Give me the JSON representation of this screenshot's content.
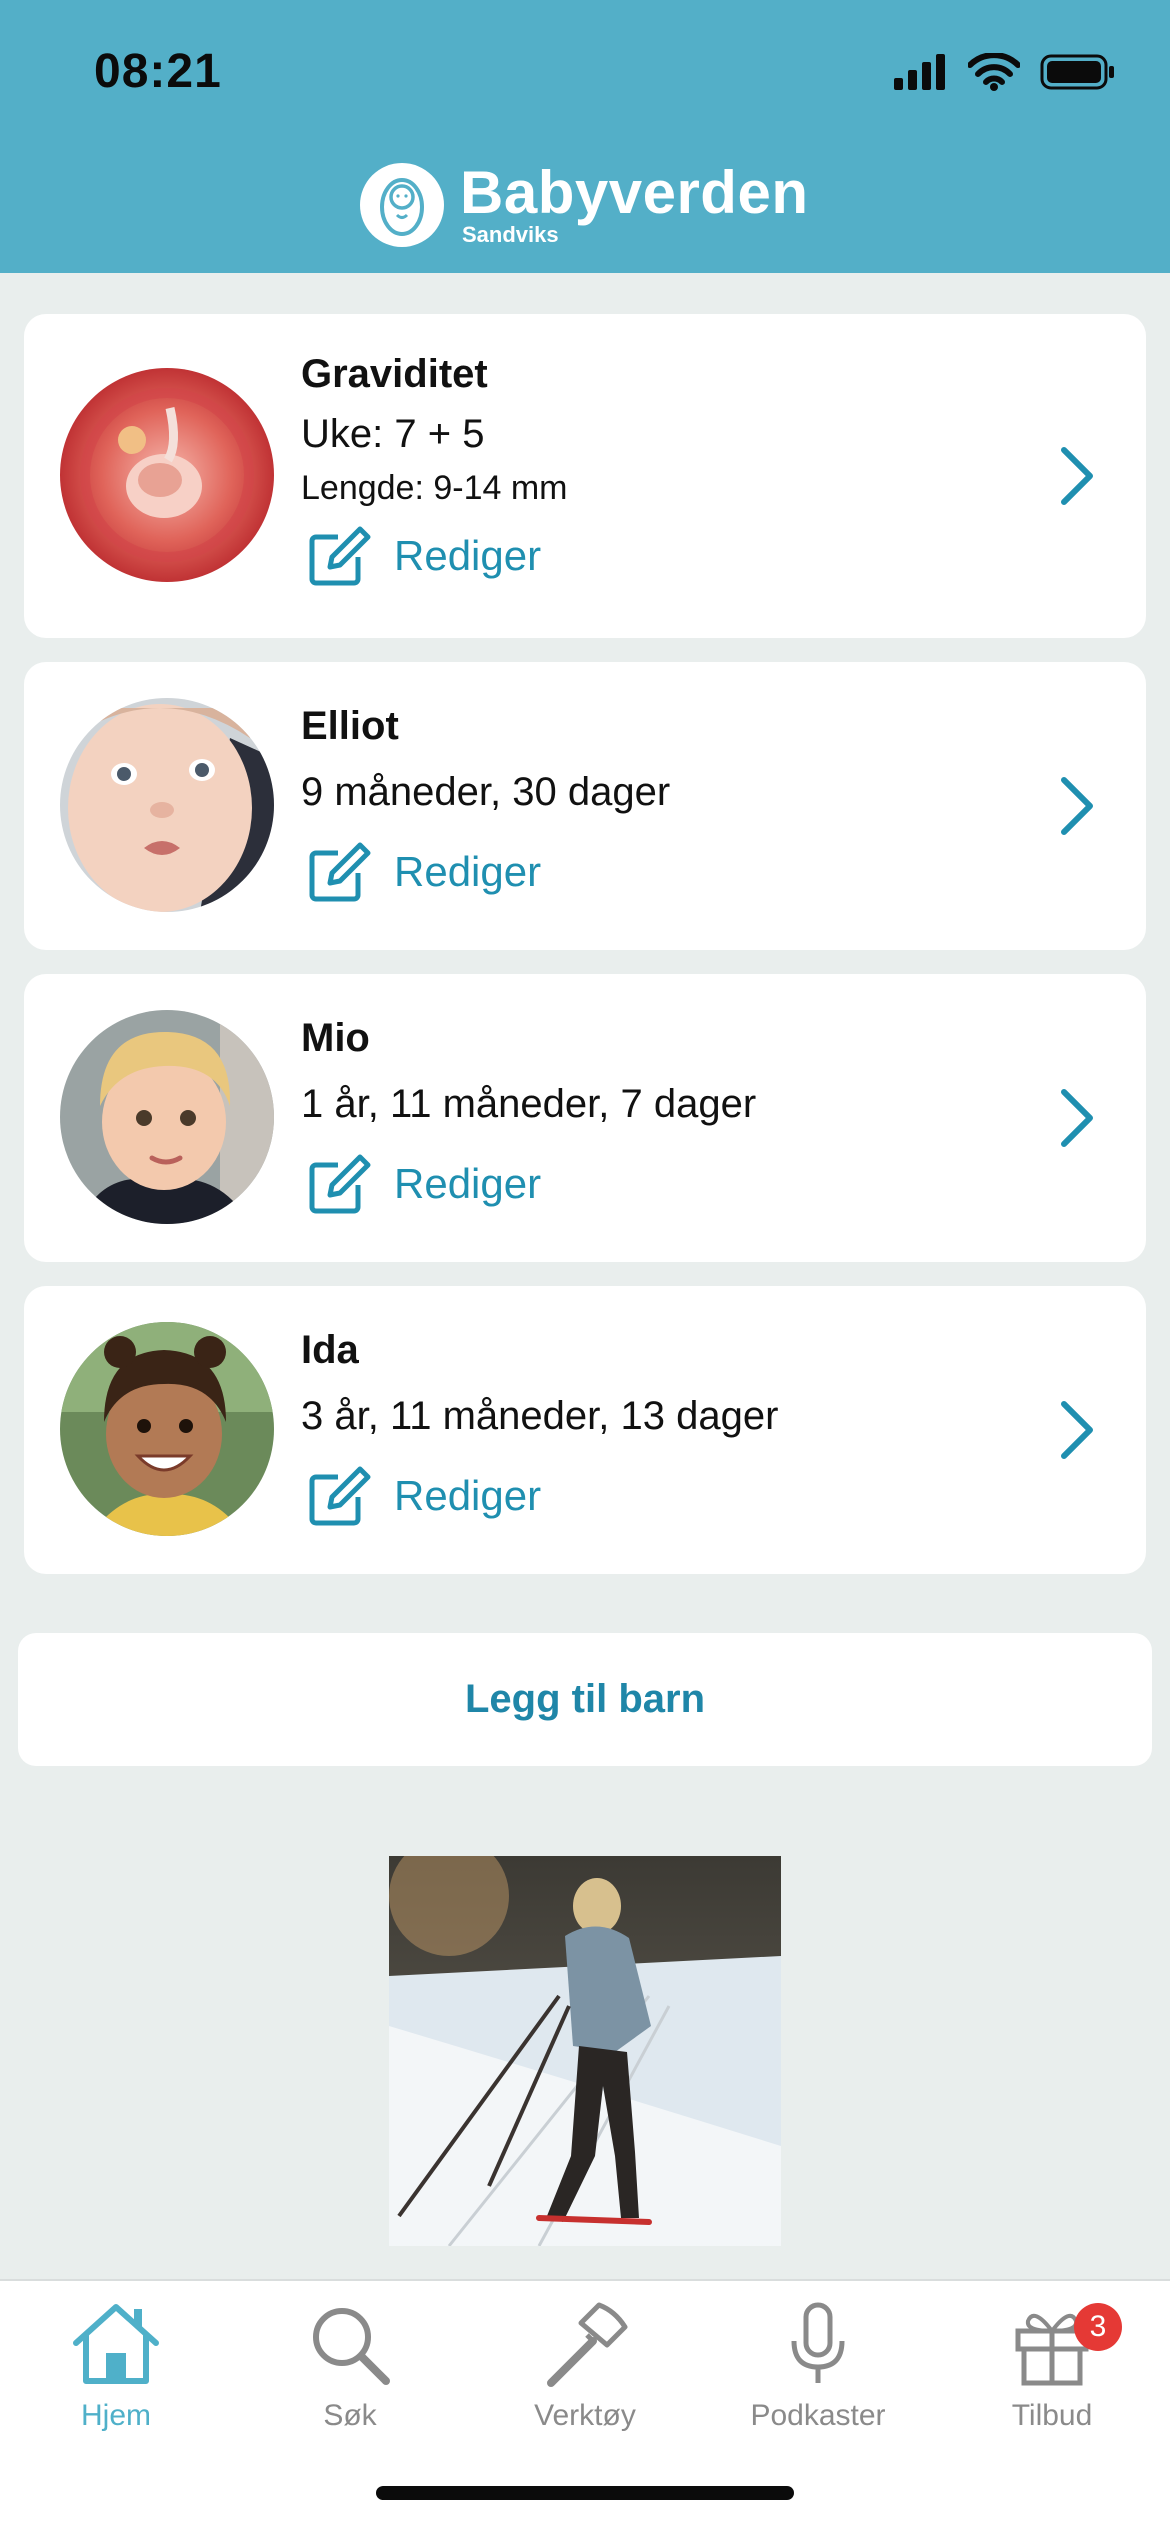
{
  "status_bar": {
    "time": "08:21"
  },
  "brand": {
    "title": "Babyverden",
    "subtitle": "Sandviks"
  },
  "colors": {
    "header_bg": "#53afc8",
    "accent": "#1f8fb0",
    "badge": "#e53935"
  },
  "cards": [
    {
      "name": "Graviditet",
      "age": "Uke: 7 + 5",
      "length": "Lengde: 9-14 mm",
      "edit_label": "Rediger"
    },
    {
      "name": "Elliot",
      "age": "9 måneder, 30 dager",
      "edit_label": "Rediger"
    },
    {
      "name": "Mio",
      "age": "1 år, 11 måneder, 7 dager",
      "edit_label": "Rediger"
    },
    {
      "name": "Ida",
      "age": "3 år, 11 måneder, 13 dager",
      "edit_label": "Rediger"
    }
  ],
  "add_child": {
    "label": "Legg til barn"
  },
  "tabs": [
    {
      "label": "Hjem",
      "icon": "home-icon",
      "active": true
    },
    {
      "label": "Søk",
      "icon": "search-icon"
    },
    {
      "label": "Verktøy",
      "icon": "hammer-icon"
    },
    {
      "label": "Podkaster",
      "icon": "microphone-icon"
    },
    {
      "label": "Tilbud",
      "icon": "gift-icon",
      "badge": "3"
    }
  ]
}
